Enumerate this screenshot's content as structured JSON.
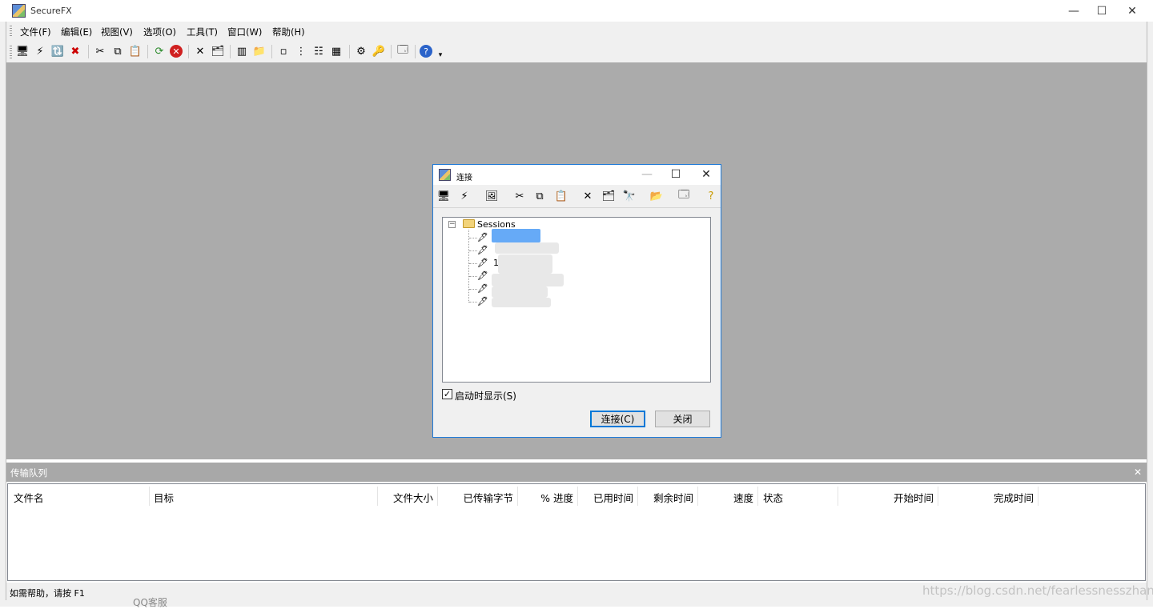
{
  "app": {
    "title": "SecureFX"
  },
  "window_controls": {
    "minimize": "—",
    "maximize": "☐",
    "close": "✕"
  },
  "menubar": {
    "items": [
      "文件(F)",
      "编辑(E)",
      "视图(V)",
      "选项(O)",
      "工具(T)",
      "窗口(W)",
      "帮助(H)"
    ]
  },
  "toolbar": {
    "icons": [
      "connect-icon",
      "quick-connect-icon",
      "connect-tab-icon",
      "disconnect-icon",
      "cut-icon",
      "copy-icon",
      "paste-icon",
      "refresh-icon",
      "stop-icon",
      "delete-icon",
      "properties-icon",
      "view-icon",
      "folder-up-icon",
      "list-icon",
      "tree-icon",
      "details-icon",
      "report-icon",
      "transfer-settings-icon",
      "key-icon",
      "session-manager-icon",
      "help-icon",
      "overflow-icon"
    ]
  },
  "connect_dialog": {
    "title": "连接",
    "tree": {
      "root": "Sessions",
      "session_visible_text": [
        "",
        "",
        "1",
        "",
        "",
        ""
      ]
    },
    "startup_checkbox": {
      "label": "启动时显示(S)",
      "checked": true,
      "mark": "✓"
    },
    "connect_button": "连接(C)",
    "close_button": "关闭"
  },
  "transfer_queue": {
    "title": "传输队列",
    "close": "✕",
    "columns": [
      "文件名",
      "目标",
      "文件大小",
      "已传输字节",
      "% 进度",
      "已用时间",
      "剩余时间",
      "速度",
      "状态",
      "开始时间",
      "完成时间"
    ]
  },
  "statusbar": {
    "text": "如需帮助，请按 F1"
  },
  "watermark": "https://blog.csdn.net/fearlessnesszhang",
  "taskbar_fragment": "QQ客服"
}
